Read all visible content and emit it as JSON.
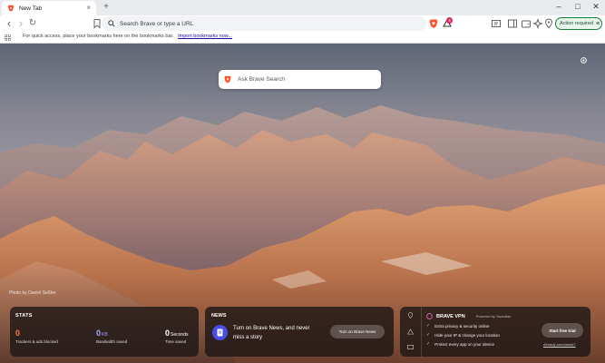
{
  "tab": {
    "title": "New Tab",
    "close": "×",
    "new_tab": "+"
  },
  "window_controls": {
    "minimize": "–",
    "maximize": "□",
    "close": "✕"
  },
  "toolbar": {
    "back": "‹",
    "forward": "›",
    "reload": "↻",
    "omnibox_placeholder": "Search Brave or type a URL",
    "rewards_badge": "4",
    "action_required": "Action required",
    "menu": "≡"
  },
  "bookmarks_bar": {
    "message": "For quick access, place your bookmarks here on the bookmarks bar.",
    "import_link": "Import bookmarks now..."
  },
  "new_tab_page": {
    "search_placeholder": "Ask Brave Search",
    "photo_credit": "Photo by Daniel Seßler"
  },
  "stats": {
    "title": "STATS",
    "items": [
      {
        "value": "0",
        "unit": "",
        "label": "Trackers & ads blocked",
        "color": "#ff7a3d"
      },
      {
        "value": "0",
        "unit": "KB",
        "label": "Bandwidth saved",
        "color": "#a3a7ff"
      },
      {
        "value": "0",
        "unit": "Seconds",
        "label": "Time saved",
        "color": "#ffffff"
      }
    ]
  },
  "news": {
    "title": "NEWS",
    "text": "Turn on Brave News, and never miss a story",
    "button": "Turn on Brave News"
  },
  "vpn": {
    "title": "BRAVE VPN",
    "powered_by": "Powered by  Guardian",
    "features": [
      "Extra privacy & security online",
      "Hide your IP & change your location",
      "Protect every app on your device"
    ],
    "trial_button": "Start free trial",
    "already_link": "Already purchased?"
  },
  "colors": {
    "brave_orange": "#fb542b",
    "accent_green": "#1a7f37"
  }
}
